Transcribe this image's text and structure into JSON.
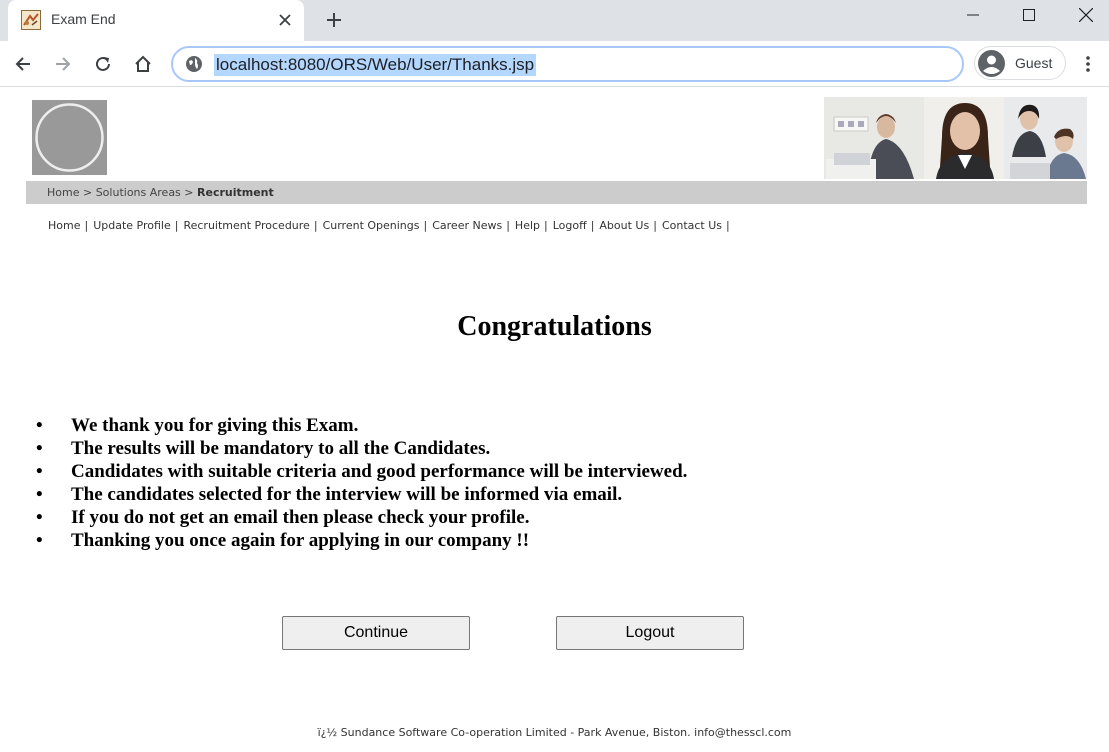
{
  "browser": {
    "tab_title": "Exam End",
    "url": "localhost:8080/ORS/Web/User/Thanks.jsp",
    "profile_name": "Guest"
  },
  "breadcrumb": {
    "items": [
      "Home",
      "Solutions Areas"
    ],
    "separator": ">",
    "current": "Recruitment"
  },
  "nav": {
    "links": [
      "Home",
      "Update Profile",
      "Recruitment Procedure",
      "Current Openings",
      "Career News",
      "Help",
      "Logoff",
      "About Us",
      "Contact Us"
    ],
    "separator": "|"
  },
  "main": {
    "heading": "Congratulations",
    "bullets": [
      "We thank you for giving this Exam.",
      "The results will be mandatory to all the Candidates.",
      "Candidates with suitable criteria and good performance will be interviewed.",
      "The candidates selected for the interview will be informed via email.",
      "If you do not get an email then please check your profile.",
      "Thanking you once again for applying in our company !!"
    ]
  },
  "buttons": {
    "continue": "Continue",
    "logout": "Logout"
  },
  "footer": {
    "text": "ï¿½ Sundance Software Co-operation Limited - Park Avenue, Biston. info@thesscl.com"
  },
  "colors": {
    "tabbar_bg": "#dee1e6",
    "omnibox_border": "#a8c7fa",
    "url_selection": "#b3d7ff",
    "crumb_bar_bg": "#cccccc",
    "logo_bg": "#999999",
    "button_bg": "#efefef"
  }
}
